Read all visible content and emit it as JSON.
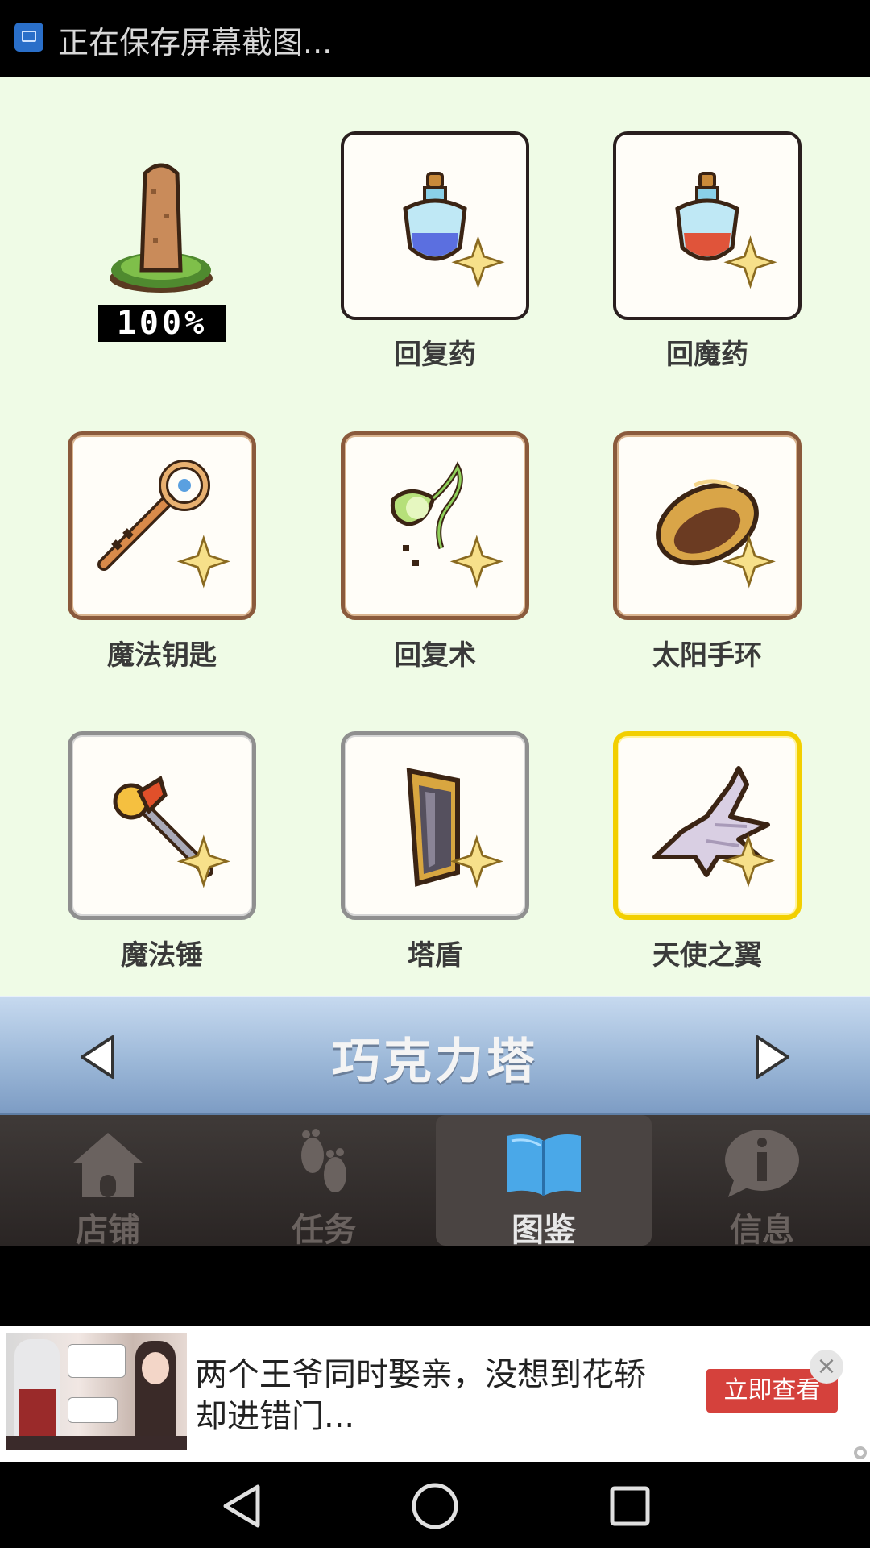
{
  "status_bar": {
    "text": "正在保存屏幕截图..."
  },
  "tower": {
    "percent": "100%"
  },
  "items": [
    {
      "label": "回复药"
    },
    {
      "label": "回魔药"
    },
    {
      "label": "魔法钥匙"
    },
    {
      "label": "回复术"
    },
    {
      "label": "太阳手环"
    },
    {
      "label": "魔法锤"
    },
    {
      "label": "塔盾"
    },
    {
      "label": "天使之翼"
    }
  ],
  "banner": {
    "title": "巧克力塔"
  },
  "nav": {
    "items": [
      {
        "label": "店铺"
      },
      {
        "label": "任务"
      },
      {
        "label": "图鉴"
      },
      {
        "label": "信息"
      }
    ],
    "active": "图鉴"
  },
  "ad": {
    "line1": "两个王爷同时娶亲，没想到花轿",
    "line2": "却进错门...",
    "button": "立即查看",
    "close": "×"
  },
  "colors": {
    "background": "#effbe6",
    "banner": "#9cb8d8",
    "ad_button": "#d5413c",
    "gold_frame": "#f2cf00"
  }
}
